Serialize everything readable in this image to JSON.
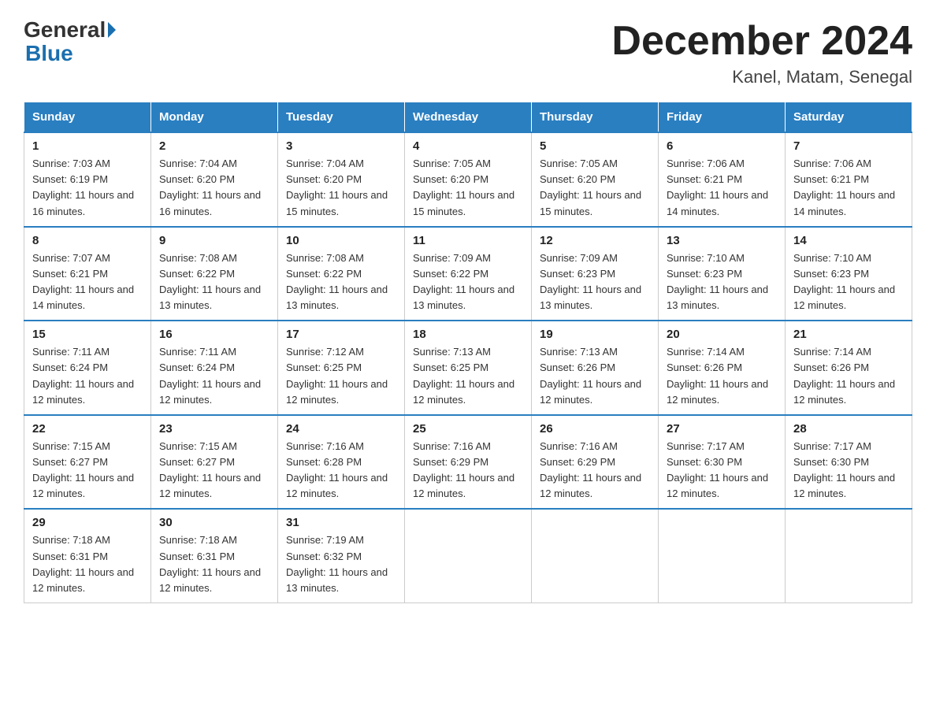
{
  "header": {
    "logo_general": "General",
    "logo_blue": "Blue",
    "month_title": "December 2024",
    "location": "Kanel, Matam, Senegal"
  },
  "days_of_week": [
    "Sunday",
    "Monday",
    "Tuesday",
    "Wednesday",
    "Thursday",
    "Friday",
    "Saturday"
  ],
  "weeks": [
    [
      {
        "day": "1",
        "sunrise": "7:03 AM",
        "sunset": "6:19 PM",
        "daylight": "11 hours and 16 minutes."
      },
      {
        "day": "2",
        "sunrise": "7:04 AM",
        "sunset": "6:20 PM",
        "daylight": "11 hours and 16 minutes."
      },
      {
        "day": "3",
        "sunrise": "7:04 AM",
        "sunset": "6:20 PM",
        "daylight": "11 hours and 15 minutes."
      },
      {
        "day": "4",
        "sunrise": "7:05 AM",
        "sunset": "6:20 PM",
        "daylight": "11 hours and 15 minutes."
      },
      {
        "day": "5",
        "sunrise": "7:05 AM",
        "sunset": "6:20 PM",
        "daylight": "11 hours and 15 minutes."
      },
      {
        "day": "6",
        "sunrise": "7:06 AM",
        "sunset": "6:21 PM",
        "daylight": "11 hours and 14 minutes."
      },
      {
        "day": "7",
        "sunrise": "7:06 AM",
        "sunset": "6:21 PM",
        "daylight": "11 hours and 14 minutes."
      }
    ],
    [
      {
        "day": "8",
        "sunrise": "7:07 AM",
        "sunset": "6:21 PM",
        "daylight": "11 hours and 14 minutes."
      },
      {
        "day": "9",
        "sunrise": "7:08 AM",
        "sunset": "6:22 PM",
        "daylight": "11 hours and 13 minutes."
      },
      {
        "day": "10",
        "sunrise": "7:08 AM",
        "sunset": "6:22 PM",
        "daylight": "11 hours and 13 minutes."
      },
      {
        "day": "11",
        "sunrise": "7:09 AM",
        "sunset": "6:22 PM",
        "daylight": "11 hours and 13 minutes."
      },
      {
        "day": "12",
        "sunrise": "7:09 AM",
        "sunset": "6:23 PM",
        "daylight": "11 hours and 13 minutes."
      },
      {
        "day": "13",
        "sunrise": "7:10 AM",
        "sunset": "6:23 PM",
        "daylight": "11 hours and 13 minutes."
      },
      {
        "day": "14",
        "sunrise": "7:10 AM",
        "sunset": "6:23 PM",
        "daylight": "11 hours and 12 minutes."
      }
    ],
    [
      {
        "day": "15",
        "sunrise": "7:11 AM",
        "sunset": "6:24 PM",
        "daylight": "11 hours and 12 minutes."
      },
      {
        "day": "16",
        "sunrise": "7:11 AM",
        "sunset": "6:24 PM",
        "daylight": "11 hours and 12 minutes."
      },
      {
        "day": "17",
        "sunrise": "7:12 AM",
        "sunset": "6:25 PM",
        "daylight": "11 hours and 12 minutes."
      },
      {
        "day": "18",
        "sunrise": "7:13 AM",
        "sunset": "6:25 PM",
        "daylight": "11 hours and 12 minutes."
      },
      {
        "day": "19",
        "sunrise": "7:13 AM",
        "sunset": "6:26 PM",
        "daylight": "11 hours and 12 minutes."
      },
      {
        "day": "20",
        "sunrise": "7:14 AM",
        "sunset": "6:26 PM",
        "daylight": "11 hours and 12 minutes."
      },
      {
        "day": "21",
        "sunrise": "7:14 AM",
        "sunset": "6:26 PM",
        "daylight": "11 hours and 12 minutes."
      }
    ],
    [
      {
        "day": "22",
        "sunrise": "7:15 AM",
        "sunset": "6:27 PM",
        "daylight": "11 hours and 12 minutes."
      },
      {
        "day": "23",
        "sunrise": "7:15 AM",
        "sunset": "6:27 PM",
        "daylight": "11 hours and 12 minutes."
      },
      {
        "day": "24",
        "sunrise": "7:16 AM",
        "sunset": "6:28 PM",
        "daylight": "11 hours and 12 minutes."
      },
      {
        "day": "25",
        "sunrise": "7:16 AM",
        "sunset": "6:29 PM",
        "daylight": "11 hours and 12 minutes."
      },
      {
        "day": "26",
        "sunrise": "7:16 AM",
        "sunset": "6:29 PM",
        "daylight": "11 hours and 12 minutes."
      },
      {
        "day": "27",
        "sunrise": "7:17 AM",
        "sunset": "6:30 PM",
        "daylight": "11 hours and 12 minutes."
      },
      {
        "day": "28",
        "sunrise": "7:17 AM",
        "sunset": "6:30 PM",
        "daylight": "11 hours and 12 minutes."
      }
    ],
    [
      {
        "day": "29",
        "sunrise": "7:18 AM",
        "sunset": "6:31 PM",
        "daylight": "11 hours and 12 minutes."
      },
      {
        "day": "30",
        "sunrise": "7:18 AM",
        "sunset": "6:31 PM",
        "daylight": "11 hours and 12 minutes."
      },
      {
        "day": "31",
        "sunrise": "7:19 AM",
        "sunset": "6:32 PM",
        "daylight": "11 hours and 13 minutes."
      },
      null,
      null,
      null,
      null
    ]
  ]
}
